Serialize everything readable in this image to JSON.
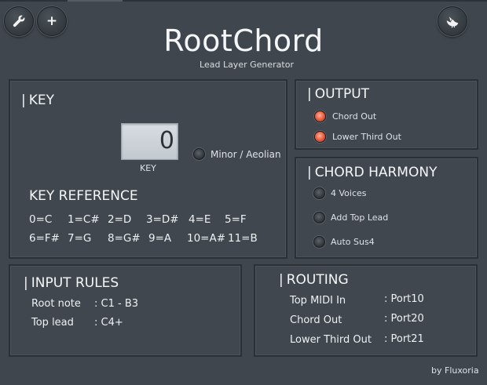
{
  "app": {
    "title": "RootChord",
    "subtitle": "Lead Layer Generator",
    "credit": "by Fluxoria"
  },
  "toolbar": {
    "settings_icon": "wrench-icon",
    "add_icon": "plus-icon",
    "add_label": "+",
    "brand_icon": "bird-logo-icon"
  },
  "key_panel": {
    "title": "KEY",
    "display_value": "0",
    "display_label": "KEY",
    "minor_label": "Minor / Aeolian",
    "minor_on": false,
    "reference_title": "KEY REFERENCE",
    "reference_rows": [
      [
        "0=C",
        "1=C#",
        "2=D",
        "3=D#",
        "4=E",
        "5=F"
      ],
      [
        "6=F#",
        "7=G",
        "8=G#",
        "9=A",
        "10=A#",
        "11=B"
      ]
    ]
  },
  "output_panel": {
    "title": "OUTPUT",
    "items": [
      {
        "label": "Chord Out",
        "on": true
      },
      {
        "label": "Lower Third Out",
        "on": true
      }
    ]
  },
  "harmony_panel": {
    "title": "CHORD HARMONY",
    "items": [
      {
        "label": "4 Voices",
        "on": false
      },
      {
        "label": "Add Top Lead",
        "on": false
      },
      {
        "label": "Auto Sus4",
        "on": false
      }
    ]
  },
  "input_rules_panel": {
    "title": "INPUT RULES",
    "rows": [
      {
        "label": "Root note",
        "value": ": C1 - B3"
      },
      {
        "label": "Top lead",
        "value": ": C4+"
      }
    ]
  },
  "routing_panel": {
    "title": "ROUTING",
    "rows": [
      {
        "label": "Top MIDI In",
        "value": ": Port10"
      },
      {
        "label": "Chord Out",
        "value": ": Port20"
      },
      {
        "label": "Lower Third Out",
        "value": ": Port21"
      }
    ]
  },
  "colors": {
    "background": "#3f464d",
    "panel_border": "#2a3035",
    "led_on": "#e6573a",
    "display_bg": "#cfd6db"
  }
}
